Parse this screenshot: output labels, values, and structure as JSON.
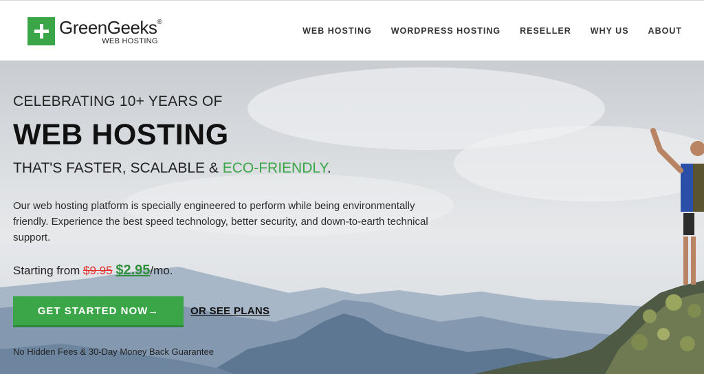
{
  "header": {
    "logo": {
      "name": "GreenGeeks",
      "registered": "®",
      "subtitle": "WEB HOSTING"
    },
    "nav": [
      {
        "label": "WEB HOSTING"
      },
      {
        "label": "WORDPRESS HOSTING"
      },
      {
        "label": "RESELLER"
      },
      {
        "label": "WHY US"
      },
      {
        "label": "ABOUT"
      }
    ]
  },
  "hero": {
    "eyebrow": "CELEBRATING 10+ YEARS OF",
    "headline": "WEB HOSTING",
    "tagline_prefix": "THAT'S FASTER, SCALABLE & ",
    "tagline_highlight": "ECO-FRIENDLY",
    "tagline_suffix": ".",
    "description": "Our web hosting platform is specially engineered to perform while being environmentally friendly. Experience the best speed technology, better security, and down-to-earth technical support.",
    "price_prefix": "Starting from ",
    "price_old": "$9.95",
    "price_new": "$2.95",
    "price_suffix": "/mo.",
    "cta_label": "GET STARTED NOW→",
    "secondary_link": "OR SEE PLANS",
    "guarantee": "No Hidden Fees & 30-Day Money Back Guarantee"
  },
  "colors": {
    "brand_green": "#3aa648",
    "old_price_red": "#e32d2d",
    "new_price_green": "#2f8f3a"
  }
}
